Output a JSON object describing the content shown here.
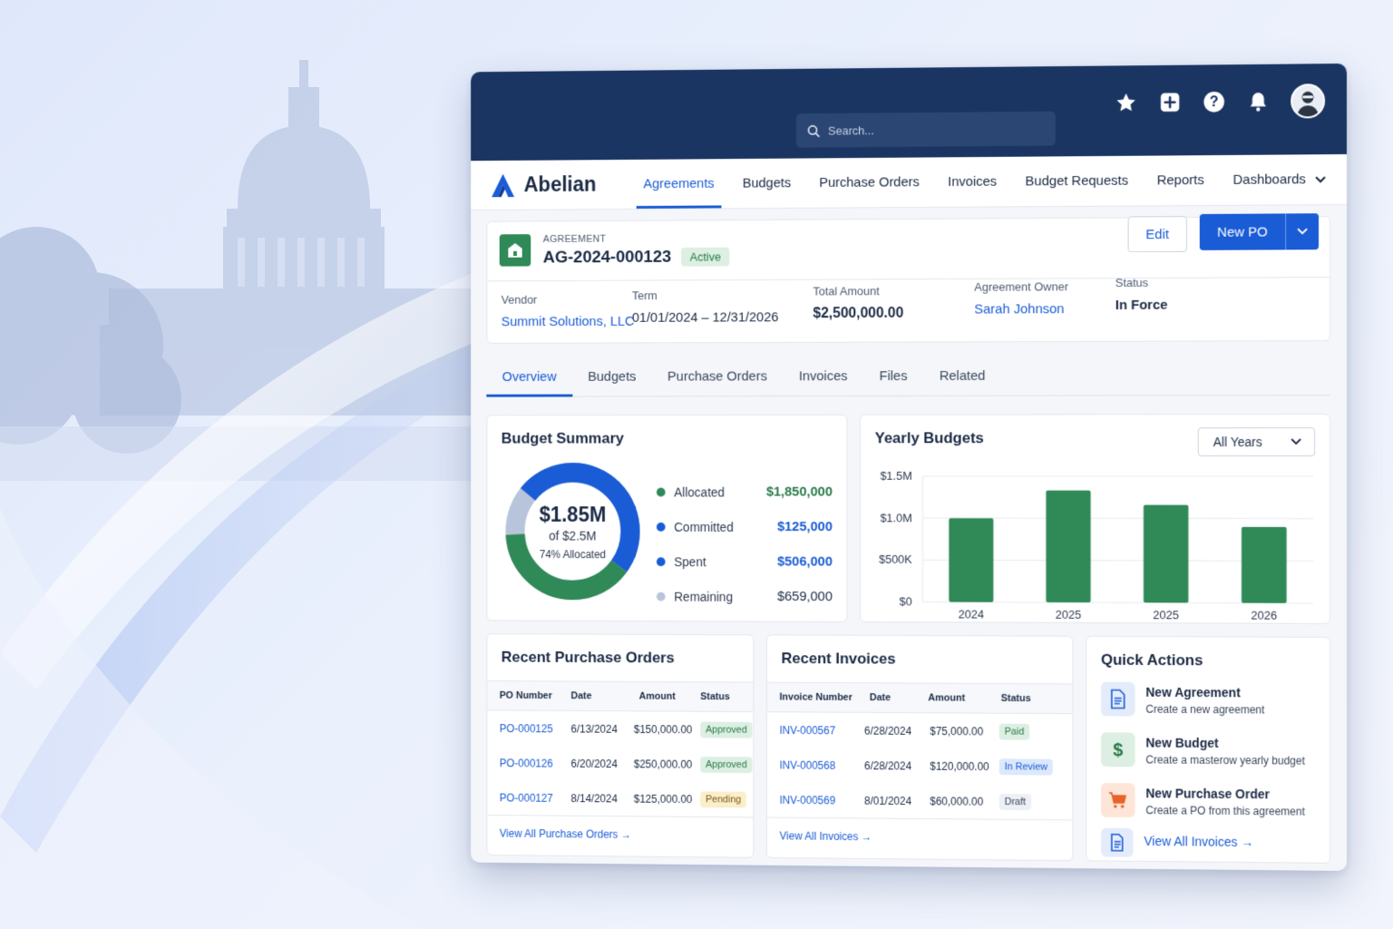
{
  "topbar": {
    "search_placeholder": "Search...",
    "icons": [
      "star-icon",
      "plus-square-icon",
      "help-icon",
      "bell-icon",
      "user-avatar"
    ]
  },
  "brand": {
    "name": "Abelian"
  },
  "nav": {
    "items": [
      {
        "label": "Agreements",
        "active": true
      },
      {
        "label": "Budgets"
      },
      {
        "label": "Purchase Orders"
      },
      {
        "label": "Invoices"
      },
      {
        "label": "Budget Requests"
      },
      {
        "label": "Reports"
      },
      {
        "label": "Dashboards"
      }
    ]
  },
  "agreement": {
    "eyebrow": "AGREEMENT",
    "id": "AG-2024-000123",
    "badge": "Active",
    "edit_label": "Edit",
    "new_po_label": "New PO",
    "fields": {
      "vendor_label": "Vendor",
      "vendor_value": "Summit Solutions, LLC",
      "term_label": "Term",
      "term_value": "01/01/2024 – 12/31/2026",
      "total_label": "Total Amount",
      "total_value": "$2,500,000.00",
      "owner_label": "Agreement Owner",
      "owner_value": "Sarah Johnson",
      "status_label": "Status",
      "status_value": "In Force"
    }
  },
  "tabs": [
    "Overview",
    "Budgets",
    "Purchase Orders",
    "Invoices",
    "Files",
    "Related"
  ],
  "budget_summary": {
    "title": "Budget Summary",
    "center_value": "$1.85M",
    "center_sub": "of $2.5M",
    "center_note": "74% Allocated",
    "allocated_fraction": 0.74,
    "legend": [
      {
        "name": "Allocated",
        "value": "$1,850,000",
        "color": "#2f8a58"
      },
      {
        "name": "Committed",
        "value": "$125,000",
        "color": "#1a5cd6"
      },
      {
        "name": "Spent",
        "value": "$506,000",
        "color": "#1a5cd6"
      },
      {
        "name": "Remaining",
        "value": "$659,000",
        "color": "#b8c4dc"
      }
    ]
  },
  "yearly": {
    "title": "Yearly Budgets",
    "select_value": "All Years"
  },
  "chart_data": {
    "type": "bar",
    "categories": [
      "2024",
      "2025",
      "2026"
    ],
    "x": [
      "2024",
      "2025",
      "2025",
      "2026"
    ],
    "values": [
      1000000,
      1330000,
      1160000,
      900000
    ],
    "yticks": [
      "$0",
      "$500K",
      "$1.0M",
      "$1.5M"
    ],
    "ylim": [
      0,
      1500000
    ],
    "color": "#2f8a58"
  },
  "recent_pos": {
    "title": "Recent Purchase Orders",
    "headers": [
      "PO Number",
      "Date",
      "Amount",
      "Status"
    ],
    "rows": [
      {
        "number": "PO-000125",
        "date": "6/13/2024",
        "amount": "$150,000.00",
        "status": "Approved"
      },
      {
        "number": "PO-000126",
        "date": "6/20/2024",
        "amount": "$250,000.00",
        "status": "Approved"
      },
      {
        "number": "PO-000127",
        "date": "8/14/2024",
        "amount": "$125,000.00",
        "status": "Pending"
      }
    ],
    "footer": "View All Purchase Orders →"
  },
  "recent_invoices": {
    "title": "Recent Invoices",
    "headers": [
      "Invoice Number",
      "Date",
      "Amount",
      "Status"
    ],
    "rows": [
      {
        "number": "INV-000567",
        "date": "6/28/2024",
        "amount": "$75,000.00",
        "status": "Paid"
      },
      {
        "number": "INV-000568",
        "date": "6/28/2024",
        "amount": "$120,000.00",
        "status": "In Review"
      },
      {
        "number": "INV-000569",
        "date": "8/01/2024",
        "amount": "$60,000.00",
        "status": "Draft"
      }
    ],
    "footer": "View All Invoices →"
  },
  "quick_actions": {
    "title": "Quick Actions",
    "items": [
      {
        "title": "New Agreement",
        "desc": "Create a new agreement",
        "icon": "document-icon"
      },
      {
        "title": "New Budget",
        "desc": "Create a masterow yearly budget",
        "icon": "dollar-icon"
      },
      {
        "title": "New Purchase Order",
        "desc": "Create a PO from this agreement",
        "icon": "cart-icon"
      }
    ],
    "link": "View All Invoices →"
  }
}
